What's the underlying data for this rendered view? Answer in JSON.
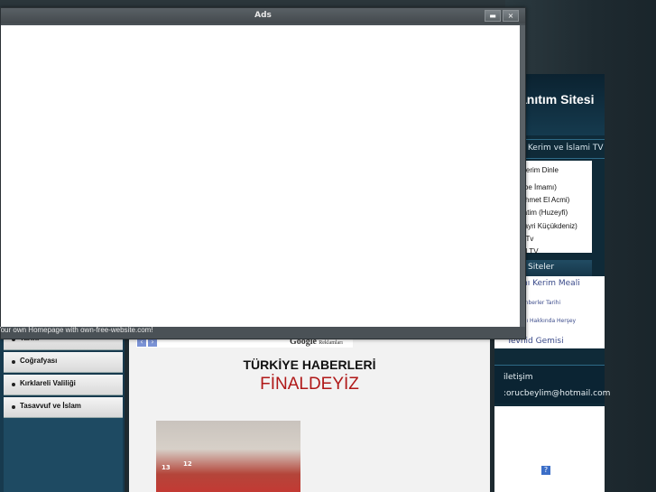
{
  "window": {
    "title": "Ads",
    "status_text": "Your own Homepage with own-free-website.com!"
  },
  "site": {
    "banner_title": "anıtım Sitesi",
    "tv_section_title": "'ı Kerim ve İslami TV",
    "tv_items": [
      "n-ı Kerim Dinle",
      "ı (Kabe İmamı)",
      "i (Ahmet El Acmi)",
      "i Hatim (Huzeyfi)",
      "( Hayri Küçükdeniz)",
      "n Tv",
      "sel TV"
    ],
    "sites_section_title": "Siteler",
    "sites_items": [
      "nı Kerim Meali",
      "anberler Tarihi",
      "nlı Hakkında Herşey",
      "Tevhid Gemisi"
    ],
    "contact_title": "iletişim",
    "contact_email": ":orucbeylim@hotmail.com"
  },
  "left_menu": [
    "Tarihi",
    "Coğrafyası",
    "Kırklareli Valiliği",
    "Tasavvuf ve İslam"
  ],
  "main": {
    "ads_label_brand": "Google",
    "ads_label_text": "Reklamları",
    "headline": "TÜRKİYE HABERLERİ",
    "subheadline": "FİNALDEYİZ"
  }
}
